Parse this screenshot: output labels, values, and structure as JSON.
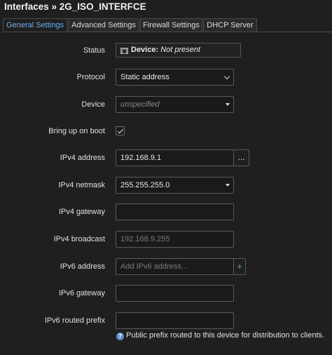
{
  "header": {
    "title": "Interfaces » 2G_ISO_INTERFCE"
  },
  "tabs": [
    {
      "label": "General Settings",
      "active": true
    },
    {
      "label": "Advanced Settings",
      "active": false
    },
    {
      "label": "Firewall Settings",
      "active": false
    },
    {
      "label": "DHCP Server",
      "active": false
    }
  ],
  "form": {
    "status": {
      "label": "Status",
      "device_key": "Device:",
      "device_value": "Not present",
      "icon": "ethernet-port-icon"
    },
    "protocol": {
      "label": "Protocol",
      "value": "Static address"
    },
    "device": {
      "label": "Device",
      "value": "unspecified"
    },
    "bring_up_on_boot": {
      "label": "Bring up on boot",
      "checked": true
    },
    "ipv4_address": {
      "label": "IPv4 address",
      "value": "192.168.9.1",
      "button": "..."
    },
    "ipv4_netmask": {
      "label": "IPv4 netmask",
      "value": "255.255.255.0"
    },
    "ipv4_gateway": {
      "label": "IPv4 gateway",
      "value": ""
    },
    "ipv4_broadcast": {
      "label": "IPv4 broadcast",
      "placeholder": "192.168.9.255"
    },
    "ipv6_address": {
      "label": "IPv6 address",
      "placeholder": "Add IPv6 address...",
      "button": "+"
    },
    "ipv6_gateway": {
      "label": "IPv6 gateway",
      "value": ""
    },
    "ipv6_routed_prefix": {
      "label": "IPv6 routed prefix",
      "value": "",
      "help": "Public prefix routed to this device for distribution to clients."
    }
  },
  "colors": {
    "accent": "#6fb0e8",
    "background": "#1f1f1f",
    "border": "#5a5a5a",
    "help_icon": "#5b8fd0",
    "plus": "#3fb0c8"
  }
}
